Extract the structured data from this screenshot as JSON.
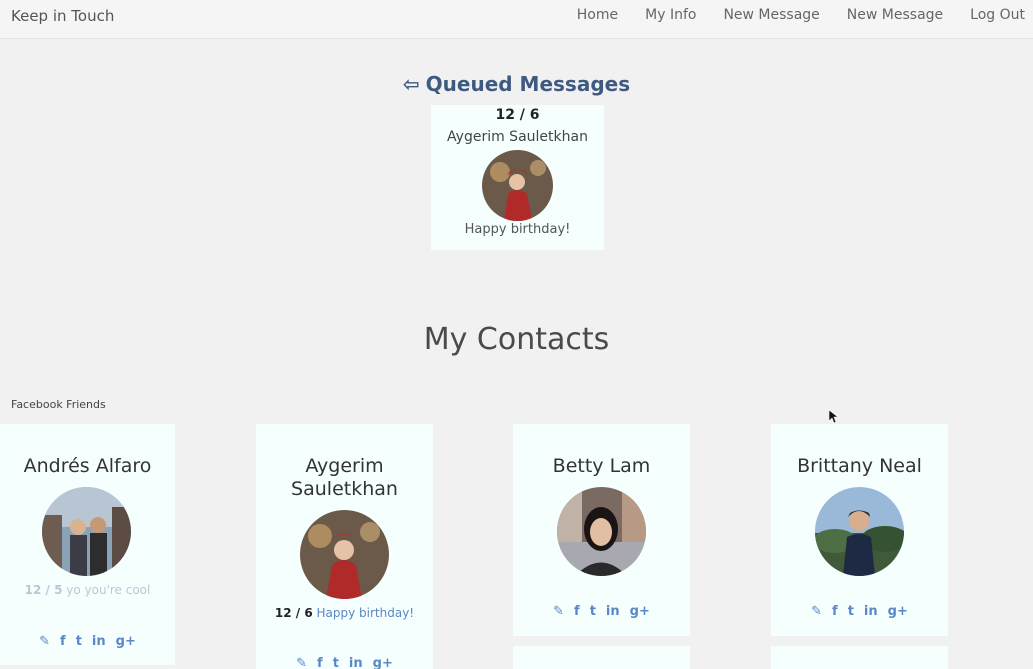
{
  "nav": {
    "brand": "Keep in Touch",
    "links": [
      "Home",
      "My Info",
      "New Message",
      "New Message",
      "Log Out"
    ]
  },
  "queued": {
    "title": "Queued Messages",
    "items": [
      {
        "date": "12 / 6",
        "name": "Aygerim Sauletkhan",
        "message": "Happy birthday!"
      }
    ]
  },
  "contacts": {
    "title": "My Contacts",
    "section_label": "Facebook Friends",
    "items": [
      {
        "name": "Andrés Alfaro",
        "note_date": "12 / 5",
        "note_text": "yo you're cool"
      },
      {
        "name": "Aygerim Sauletkhan",
        "note_date": "12 / 6",
        "note_text": "Happy birthday!"
      },
      {
        "name": "Betty Lam"
      },
      {
        "name": "Brittany Neal"
      }
    ]
  },
  "icons": [
    "edit-icon",
    "facebook-icon",
    "twitter-icon",
    "linkedin-icon",
    "google-plus-icon"
  ],
  "colors": {
    "accent": "#3f5a80",
    "card_bg": "#f5fffe",
    "social": "#5a88c6",
    "faded": "#b9c8d6"
  }
}
